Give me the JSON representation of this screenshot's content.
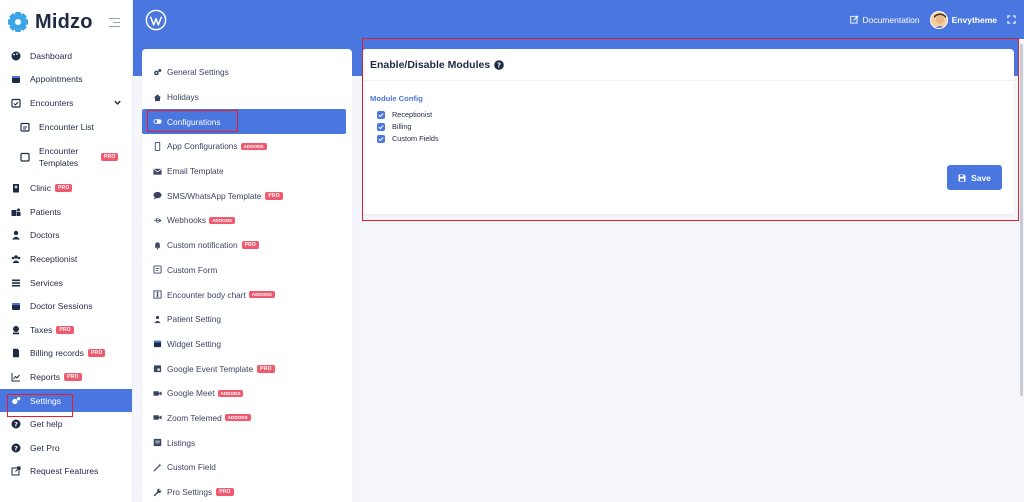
{
  "brand": {
    "name": "Midzo"
  },
  "sidebar": {
    "items": [
      {
        "label": "Dashboard",
        "icon": "palette-icon"
      },
      {
        "label": "Appointments",
        "icon": "calendar-icon"
      },
      {
        "label": "Encounters",
        "icon": "calendar-check-icon",
        "expanded": true
      },
      {
        "label": "Encounter List",
        "icon": "calendar-list-icon"
      },
      {
        "label": "Encounter Templates",
        "icon": "calendar-empty-icon",
        "badge": "PRO"
      },
      {
        "label": "Clinic",
        "icon": "hospital-icon",
        "badge": "PRO"
      },
      {
        "label": "Patients",
        "icon": "patients-icon"
      },
      {
        "label": "Doctors",
        "icon": "doctor-icon"
      },
      {
        "label": "Receptionist",
        "icon": "users-icon"
      },
      {
        "label": "Services",
        "icon": "list-icon"
      },
      {
        "label": "Doctor Sessions",
        "icon": "calendar-icon"
      },
      {
        "label": "Taxes",
        "icon": "tax-icon",
        "badge": "PRO"
      },
      {
        "label": "Billing records",
        "icon": "file-icon",
        "badge": "PRO"
      },
      {
        "label": "Reports",
        "icon": "chart-icon",
        "badge": "PRO"
      },
      {
        "label": "Settings",
        "icon": "cogs-icon",
        "active": true
      },
      {
        "label": "Get help",
        "icon": "question-icon"
      },
      {
        "label": "Get Pro",
        "icon": "question-icon"
      },
      {
        "label": "Request Features",
        "icon": "external-link-icon"
      }
    ]
  },
  "topbar": {
    "documentation_label": "Documentation",
    "username": "Envytheme"
  },
  "settings_menu": {
    "items": [
      {
        "label": "General Settings",
        "icon": "cogs-icon"
      },
      {
        "label": "Holidays",
        "icon": "home-icon"
      },
      {
        "label": "Configurations",
        "icon": "toggle-icon",
        "active": true
      },
      {
        "label": "App Configurations",
        "icon": "mobile-icon",
        "badge": "ADDONS"
      },
      {
        "label": "Email Template",
        "icon": "envelope-icon"
      },
      {
        "label": "SMS/WhatsApp Template",
        "icon": "comment-icon",
        "badge": "PRO"
      },
      {
        "label": "Webhooks",
        "icon": "usb-icon",
        "badge": "ADDONS"
      },
      {
        "label": "Custom notification",
        "icon": "bell-icon",
        "badge": "PRO"
      },
      {
        "label": "Custom Form",
        "icon": "form-icon"
      },
      {
        "label": "Encounter body chart",
        "icon": "body-chart-icon",
        "badge": "ADDONS"
      },
      {
        "label": "Patient Setting",
        "icon": "user-setting-icon"
      },
      {
        "label": "Widget Setting",
        "icon": "calendar-icon"
      },
      {
        "label": "Google Event Template",
        "icon": "calendar-event-icon",
        "badge": "PRO"
      },
      {
        "label": "Google Meet",
        "icon": "video-icon",
        "badge": "ADDONS"
      },
      {
        "label": "Zoom Telemed",
        "icon": "video-icon",
        "badge": "ADDONS"
      },
      {
        "label": "Listings",
        "icon": "listing-icon"
      },
      {
        "label": "Custom Field",
        "icon": "magic-icon"
      },
      {
        "label": "Pro Settings",
        "icon": "wrench-icon",
        "badge": "PRO"
      }
    ]
  },
  "module_card": {
    "title": "Enable/Disable Modules",
    "section_label": "Module Config",
    "modules": [
      {
        "label": "Receptionist",
        "checked": true
      },
      {
        "label": "Billing",
        "checked": true
      },
      {
        "label": "Custom Fields",
        "checked": true
      }
    ],
    "save_label": "Save"
  },
  "colors": {
    "primary": "#4a76e0",
    "badge": "#ef5a6f",
    "highlight": "#e0202e"
  }
}
